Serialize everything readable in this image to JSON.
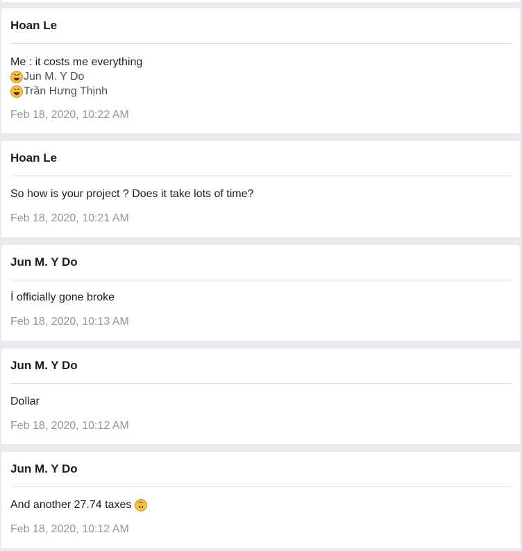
{
  "posts": [
    {
      "author": "Hoan Le",
      "text": "Me : it costs me everything",
      "reactions": [
        {
          "icon": "laughing-face-emoji",
          "name": "Jun M. Y Do"
        },
        {
          "icon": "laughing-face-emoji",
          "name": "Trần Hưng Thịnh"
        }
      ],
      "timestamp": "Feb 18, 2020, 10:22 AM"
    },
    {
      "author": "Hoan Le",
      "text": "So how is your project ? Does it take lots of time?",
      "timestamp": "Feb 18, 2020, 10:21 AM"
    },
    {
      "author": "Jun M. Y Do",
      "text": "Í officially gone broke",
      "timestamp": "Feb 18, 2020, 10:13 AM"
    },
    {
      "author": "Jun M. Y Do",
      "text": "Dollar",
      "timestamp": "Feb 18, 2020, 10:12 AM"
    },
    {
      "author": "Jun M. Y Do",
      "text": "And another 27.74 taxes",
      "text_emoji": "upside-down-face-emoji",
      "timestamp": "Feb 18, 2020, 10:12 AM"
    }
  ],
  "colors": {
    "background": "#e9ebee",
    "card": "#ffffff",
    "author_text": "#1c1e21",
    "timestamp_text": "#90949c",
    "divider": "#dadde1"
  }
}
